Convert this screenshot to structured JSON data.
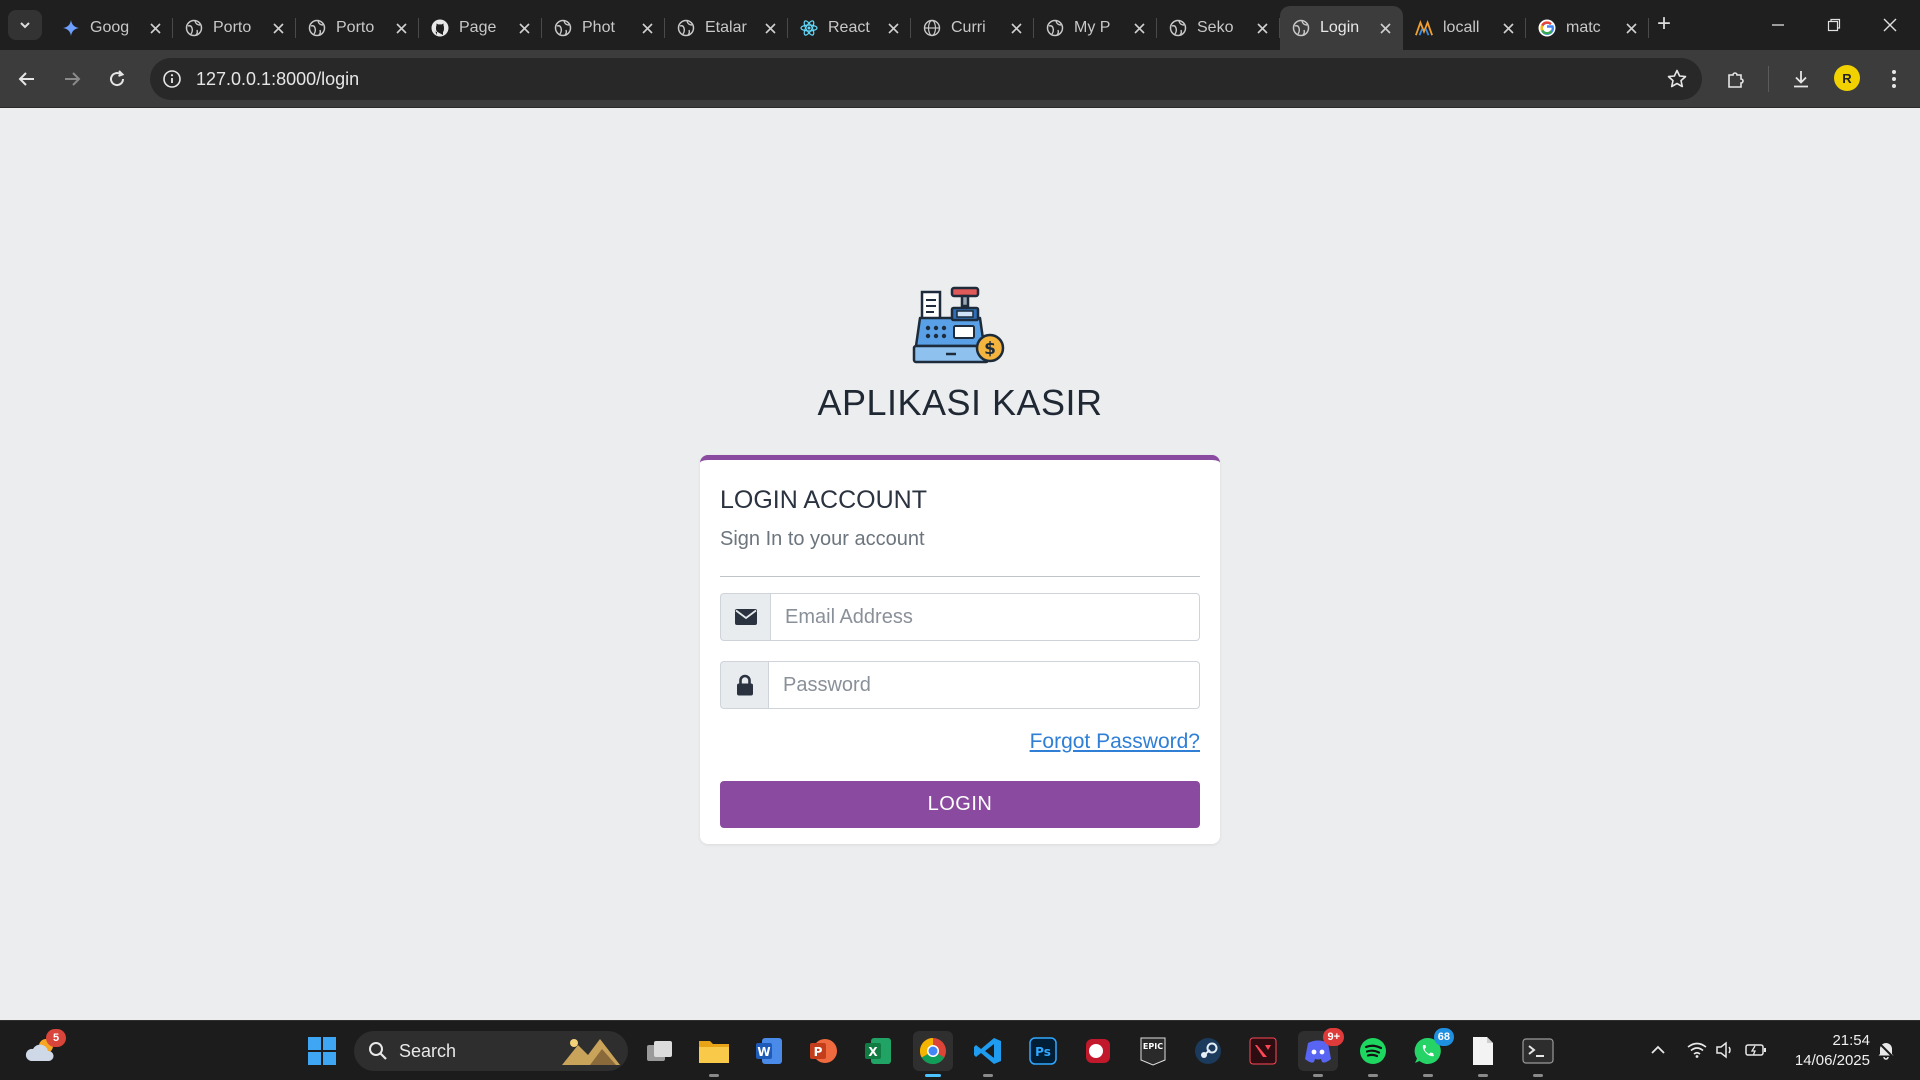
{
  "browser": {
    "tabs": [
      {
        "title": "Goog",
        "icon": "gemini-icon"
      },
      {
        "title": "Porto",
        "icon": "globe-icon"
      },
      {
        "title": "Porto",
        "icon": "globe-icon"
      },
      {
        "title": "Page",
        "icon": "github-icon"
      },
      {
        "title": "Phot",
        "icon": "globe-icon"
      },
      {
        "title": "Etalar",
        "icon": "globe-icon"
      },
      {
        "title": "React",
        "icon": "react-icon"
      },
      {
        "title": "Curri",
        "icon": "web-icon"
      },
      {
        "title": "My P",
        "icon": "globe-icon"
      },
      {
        "title": "Seko",
        "icon": "globe-icon"
      },
      {
        "title": "Login",
        "icon": "globe-icon",
        "active": true
      },
      {
        "title": "locall",
        "icon": "laragon-icon"
      },
      {
        "title": "matc",
        "icon": "google-icon"
      }
    ],
    "url": "127.0.0.1:8000/login",
    "profile_initial": "R"
  },
  "page": {
    "app_title": "APLIKASI KASIR",
    "card": {
      "title": "LOGIN ACCOUNT",
      "subtitle": "Sign In to your account",
      "email_placeholder": "Email Address",
      "password_placeholder": "Password",
      "forgot_label": "Forgot Password?",
      "login_label": "LOGIN"
    },
    "colors": {
      "accent": "#8a4a9f",
      "link": "#2f7fd6",
      "background": "#ebedef"
    }
  },
  "taskbar": {
    "weather_badge": "5",
    "search_label": "Search",
    "discord_badge": "9+",
    "whatsapp_badge": "68",
    "time": "21:54",
    "date": "14/06/2025"
  }
}
